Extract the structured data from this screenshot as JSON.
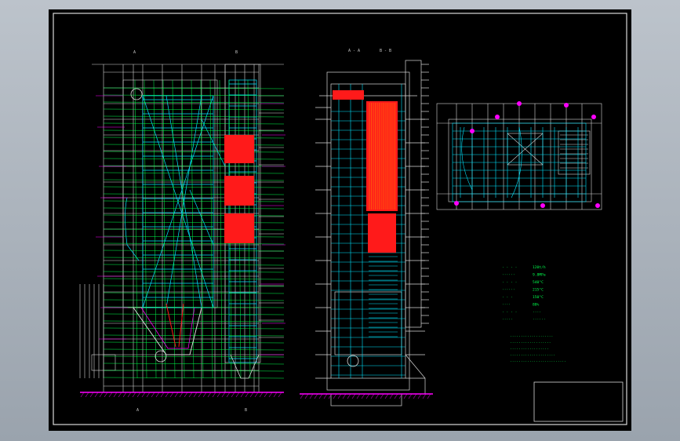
{
  "colors": {
    "background": "#000000",
    "screen": "#aab2bb",
    "white_lines": "#d8d8d8",
    "cyan_lines": "#00e5ff",
    "green_lines": "#00ff4c",
    "magenta_lines": "#ff00ff",
    "red_fill": "#ff1a1a",
    "orange_lines": "#ff8c00"
  },
  "views": {
    "elevation_labels": {
      "top_left": "A",
      "top_right": "B",
      "bottom_left": "A",
      "bottom_right": "B"
    },
    "section_labels": {
      "left": "A - A",
      "right": "B - B"
    }
  },
  "spec_table": {
    "rows": [
      {
        "key": "· · · ·",
        "value": "120t/h"
      },
      {
        "key": "······",
        "value": "9.8MPa"
      },
      {
        "key": "· · · ·",
        "value": "540°C"
      },
      {
        "key": "······",
        "value": "215°C"
      },
      {
        "key": "· · ·",
        "value": "150°C"
      },
      {
        "key": "····",
        "value": "88%"
      },
      {
        "key": "· · · ·",
        "value": "····"
      },
      {
        "key": "·····",
        "value": "······"
      }
    ],
    "notes": [
      "····················",
      "···················",
      "··················",
      "·····················",
      "··························"
    ]
  }
}
